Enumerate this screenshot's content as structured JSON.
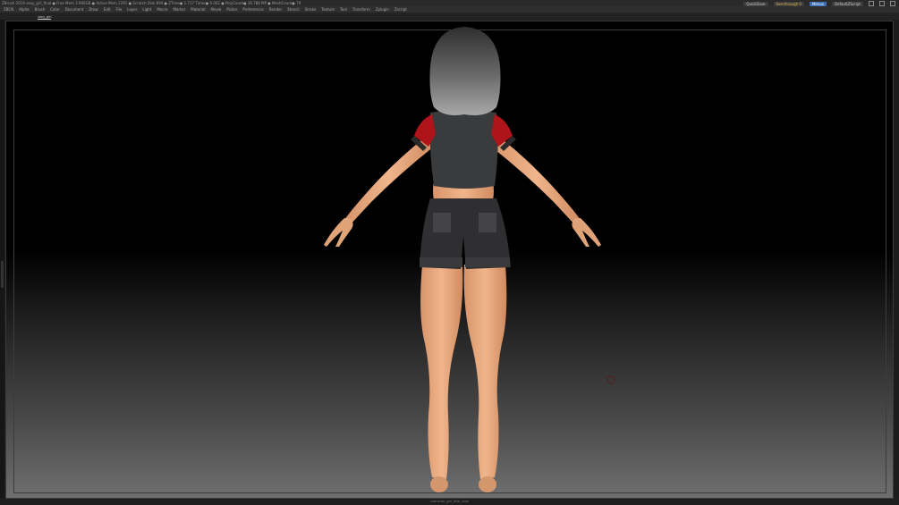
{
  "app": {
    "title": "ZBrush 2019   sexy_girl_final   ● Free Mem 3.966GB ● Active Mem 2291 ● Scratch Disk 894 ● ZTime● 1.717 Timer● 0.002 ● PolyCount● 16.788 MP ● MeshCount● 79"
  },
  "titlebar_right": {
    "quicksave": "QuickSave",
    "see_through": "See-through  0",
    "menus": "Menus",
    "script": "DefaultZScript"
  },
  "menubar": {
    "items": [
      "ZBCN",
      "Alpha",
      "Brush",
      "Color",
      "Document",
      "Draw",
      "Edit",
      "File",
      "Layer",
      "Light",
      "Macro",
      "Marker",
      "Material",
      "Movie",
      "Picker",
      "Preferences",
      "Render",
      "Stencil",
      "Stroke",
      "Texture",
      "Tool",
      "Transform",
      "Zplugin",
      "Zscript"
    ]
  },
  "subbar": {
    "active_tab": "sexy_girl"
  },
  "footer": {
    "text": "character_girl_final_view"
  },
  "colors": {
    "skin": "#e8a97e",
    "shirt": "#3a3b3d",
    "sleeve": "#b0141b",
    "shorts": "#2f2f31",
    "hair": "#6f6f6f",
    "viewport_top": "#000000",
    "viewport_bottom": "#6f6f6f"
  }
}
